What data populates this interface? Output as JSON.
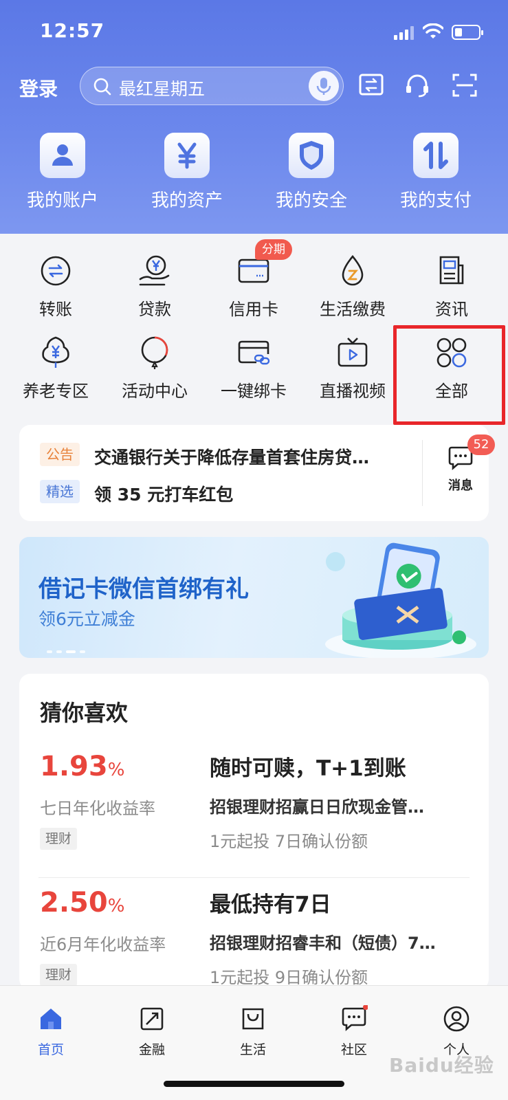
{
  "status_bar": {
    "time": "12:57"
  },
  "header": {
    "login_label": "登录",
    "search_placeholder": "最红星期五",
    "quick_tiles": [
      {
        "label": "我的账户",
        "icon": "user-icon"
      },
      {
        "label": "我的资产",
        "icon": "yen-icon"
      },
      {
        "label": "我的安全",
        "icon": "shield-icon"
      },
      {
        "label": "我的支付",
        "icon": "transfer-arrows-icon"
      }
    ]
  },
  "services": {
    "items": [
      {
        "label": "转账",
        "icon": "transfer-icon"
      },
      {
        "label": "贷款",
        "icon": "loan-icon"
      },
      {
        "label": "信用卡",
        "icon": "credit-card-icon",
        "badge": "分期"
      },
      {
        "label": "生活缴费",
        "icon": "bill-pay-icon"
      },
      {
        "label": "资讯",
        "icon": "news-icon"
      },
      {
        "label": "养老专区",
        "icon": "pension-tree-icon"
      },
      {
        "label": "活动中心",
        "icon": "balloon-icon"
      },
      {
        "label": "一键绑卡",
        "icon": "bind-card-icon"
      },
      {
        "label": "直播视频",
        "icon": "tv-icon"
      },
      {
        "label": "全部",
        "icon": "all-grid-icon"
      }
    ]
  },
  "notices": {
    "announcement_tag": "公告",
    "announcement_text": "交通银行关于降低存量首套住房贷…",
    "featured_tag": "精选",
    "featured_text": "领 35 元打车红包",
    "message_label": "消息",
    "message_count": "52"
  },
  "banner": {
    "title": "借记卡微信首绑有礼",
    "subtitle": "领6元立减金"
  },
  "recommendations": {
    "title": "猜你喜欢",
    "products": [
      {
        "rate": "1.93",
        "rate_unit": "%",
        "rate_desc": "七日年化收益率",
        "tag": "理财",
        "headline": "随时可赎，T+1到账",
        "name": "招银理财招赢日日欣现金管…",
        "detail": "1元起投 7日确认份额"
      },
      {
        "rate": "2.50",
        "rate_unit": "%",
        "rate_desc": "近6月年化收益率",
        "tag": "理财",
        "headline": "最低持有7日",
        "name": "招银理财招睿丰和（短债）7…",
        "detail": "1元起投 9日确认份额"
      }
    ]
  },
  "tabbar": {
    "active_color": "#3a68e0",
    "tabs": [
      {
        "label": "首页",
        "icon": "home-icon"
      },
      {
        "label": "金融",
        "icon": "finance-icon"
      },
      {
        "label": "生活",
        "icon": "shopping-bag-icon"
      },
      {
        "label": "社区",
        "icon": "chat-icon"
      },
      {
        "label": "个人",
        "icon": "profile-icon"
      }
    ]
  },
  "watermark": "Baidu经验"
}
